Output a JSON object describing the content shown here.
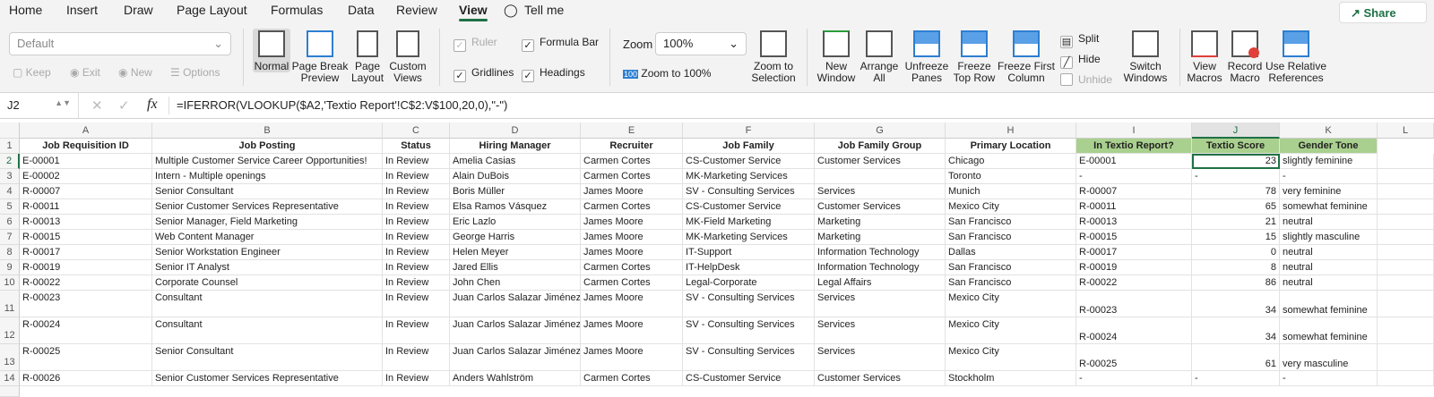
{
  "tabs": [
    "Home",
    "Insert",
    "Draw",
    "Page Layout",
    "Formulas",
    "Data",
    "Review",
    "View"
  ],
  "active_tab": "View",
  "tell_me": "Tell me",
  "share": "Share",
  "ribbon": {
    "sheet_view": "Default",
    "keep": "Keep",
    "exit": "Exit",
    "new": "New",
    "options": "Options",
    "normal": "Normal",
    "page_break_1": "Page Break",
    "page_break_2": "Preview",
    "page_layout_1": "Page",
    "page_layout_2": "Layout",
    "custom_views_1": "Custom",
    "custom_views_2": "Views",
    "ruler": "Ruler",
    "formula_bar": "Formula Bar",
    "gridlines": "Gridlines",
    "headings": "Headings",
    "zoom": "Zoom",
    "zoom_value": "100%",
    "zoom_100": "Zoom to 100%",
    "zoom_100_icon": "100",
    "zoom_sel_1": "Zoom to",
    "zoom_sel_2": "Selection",
    "new_window_1": "New",
    "new_window_2": "Window",
    "arrange_1": "Arrange",
    "arrange_2": "All",
    "unfreeze_1": "Unfreeze",
    "unfreeze_2": "Panes",
    "freeze_top_1": "Freeze",
    "freeze_top_2": "Top Row",
    "freeze_first_1": "Freeze First",
    "freeze_first_2": "Column",
    "split": "Split",
    "hide": "Hide",
    "unhide": "Unhide",
    "switch_1": "Switch",
    "switch_2": "Windows",
    "view_macros_1": "View",
    "view_macros_2": "Macros",
    "record_1": "Record",
    "record_2": "Macro",
    "relative_1": "Use Relative",
    "relative_2": "References"
  },
  "formula_bar": {
    "name_box": "J2",
    "fx": "fx",
    "formula": "=IFERROR(VLOOKUP($A2,'Textio Report'!C$2:V$100,20,0),\"-\")"
  },
  "columns": [
    "A",
    "B",
    "C",
    "D",
    "E",
    "F",
    "G",
    "H",
    "I",
    "J",
    "K",
    "L"
  ],
  "headers": [
    "Job Requisition ID",
    "Job Posting",
    "Status",
    "Hiring Manager",
    "Recruiter",
    "Job Family",
    "Job Family Group",
    "Primary Location",
    "In Textio Report?",
    "Textio Score",
    "Gender Tone"
  ],
  "rows": [
    [
      "2",
      "E-00001",
      "Multiple Customer Service Career Opportunities!",
      "In Review",
      "Amelia Casias",
      "Carmen Cortes",
      "CS-Customer Service",
      "Customer Services",
      "Chicago",
      "E-00001",
      "23",
      "slightly feminine"
    ],
    [
      "3",
      "E-00002",
      "Intern - Multiple openings",
      "In Review",
      "Alain DuBois",
      "Carmen Cortes",
      "MK-Marketing Services",
      "",
      "Toronto",
      "-",
      "-",
      "-"
    ],
    [
      "4",
      "R-00007",
      "Senior Consultant",
      "In Review",
      "Boris Müller",
      "James Moore",
      "SV - Consulting Services",
      "Services",
      "Munich",
      "R-00007",
      "78",
      "very feminine"
    ],
    [
      "5",
      "R-00011",
      "Senior Customer Services Representative",
      "In Review",
      "Elsa Ramos Vásquez",
      "Carmen Cortes",
      "CS-Customer Service",
      "Customer Services",
      "Mexico City",
      "R-00011",
      "65",
      "somewhat feminine"
    ],
    [
      "6",
      "R-00013",
      "Senior Manager, Field Marketing",
      "In Review",
      "Eric Lazlo",
      "James Moore",
      "MK-Field Marketing",
      "Marketing",
      "San Francisco",
      "R-00013",
      "21",
      "neutral"
    ],
    [
      "7",
      "R-00015",
      "Web Content Manager",
      "In Review",
      "George Harris",
      "James Moore",
      "MK-Marketing Services",
      "Marketing",
      "San Francisco",
      "R-00015",
      "15",
      "slightly masculine"
    ],
    [
      "8",
      "R-00017",
      "Senior Workstation Engineer",
      "In Review",
      "Helen Meyer",
      "James Moore",
      "IT-Support",
      "Information Technology",
      "Dallas",
      "R-00017",
      "0",
      "neutral"
    ],
    [
      "9",
      "R-00019",
      "Senior IT Analyst",
      "In Review",
      "Jared Ellis",
      "Carmen Cortes",
      "IT-HelpDesk",
      "Information Technology",
      "San Francisco",
      "R-00019",
      "8",
      "neutral"
    ],
    [
      "10",
      "R-00022",
      "Corporate Counsel",
      "In Review",
      "John Chen",
      "Carmen Cortes",
      "Legal-Corporate",
      "Legal Affairs",
      "San Francisco",
      "R-00022",
      "86",
      "neutral"
    ],
    [
      "11",
      "R-00023",
      "Consultant",
      "In Review",
      "Juan Carlos Salazar Jiménez",
      "James Moore",
      "SV - Consulting Services",
      "Services",
      "Mexico City",
      "R-00023",
      "34",
      "somewhat feminine"
    ],
    [
      "12",
      "R-00024",
      "Consultant",
      "In Review",
      "Juan Carlos Salazar Jiménez",
      "James Moore",
      "SV - Consulting Services",
      "Services",
      "Mexico City",
      "R-00024",
      "34",
      "somewhat feminine"
    ],
    [
      "13",
      "R-00025",
      "Senior Consultant",
      "In Review",
      "Juan Carlos Salazar Jiménez",
      "James Moore",
      "SV - Consulting Services",
      "Services",
      "Mexico City",
      "R-00025",
      "61",
      "very masculine"
    ],
    [
      "14",
      "R-00026",
      "Senior Customer Services Representative",
      "In Review",
      "Anders Wahlström",
      "Carmen Cortes",
      "CS-Customer Service",
      "Customer Services",
      "Stockholm",
      "-",
      "-",
      "-"
    ]
  ],
  "header_row_num": "1",
  "colors": {
    "accent": "#1e7145",
    "header_fill": "#a9d08e"
  }
}
